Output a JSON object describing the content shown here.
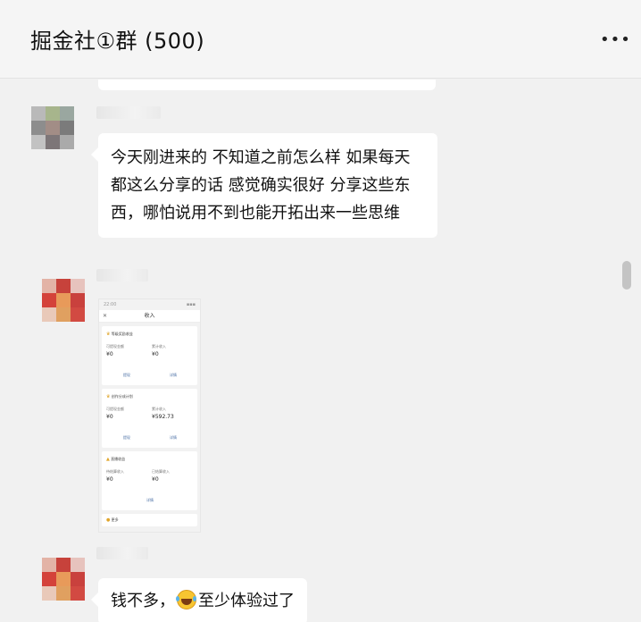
{
  "header": {
    "title": "掘金社①群 (500)",
    "more_icon": "more-icon"
  },
  "messages": [
    {
      "text": "今天刚进来的 不知道之前怎么样 如果每天都这么分享的话 感觉确实很好 分享这些东西，哪怕说用不到也能开拓出来一些思维"
    },
    {
      "screenshot": {
        "time": "22:00",
        "nav_title": "收入",
        "cards": [
          {
            "title": "等级奖励收益",
            "label_left": "可提现金额",
            "label_right": "累计收入",
            "value_left": "¥0",
            "value_right": "¥0",
            "btn_left": "提现",
            "btn_right": "详情"
          },
          {
            "title": "创作分成计划",
            "label_left": "可提现金额",
            "label_right": "累计收入",
            "value_left": "¥0",
            "value_right": "¥592.73",
            "btn_left": "提现",
            "btn_right": "详情"
          },
          {
            "title": "直播收益",
            "label_left": "待结算收入",
            "label_right": "已结算收入",
            "value_left": "¥0",
            "value_right": "¥0",
            "btn_center": "详情"
          },
          {
            "title": "更多"
          }
        ]
      }
    },
    {
      "text_before": "钱不多，",
      "emoji": "laughing-crying-emoji",
      "text_after": "至少体验过了"
    }
  ]
}
